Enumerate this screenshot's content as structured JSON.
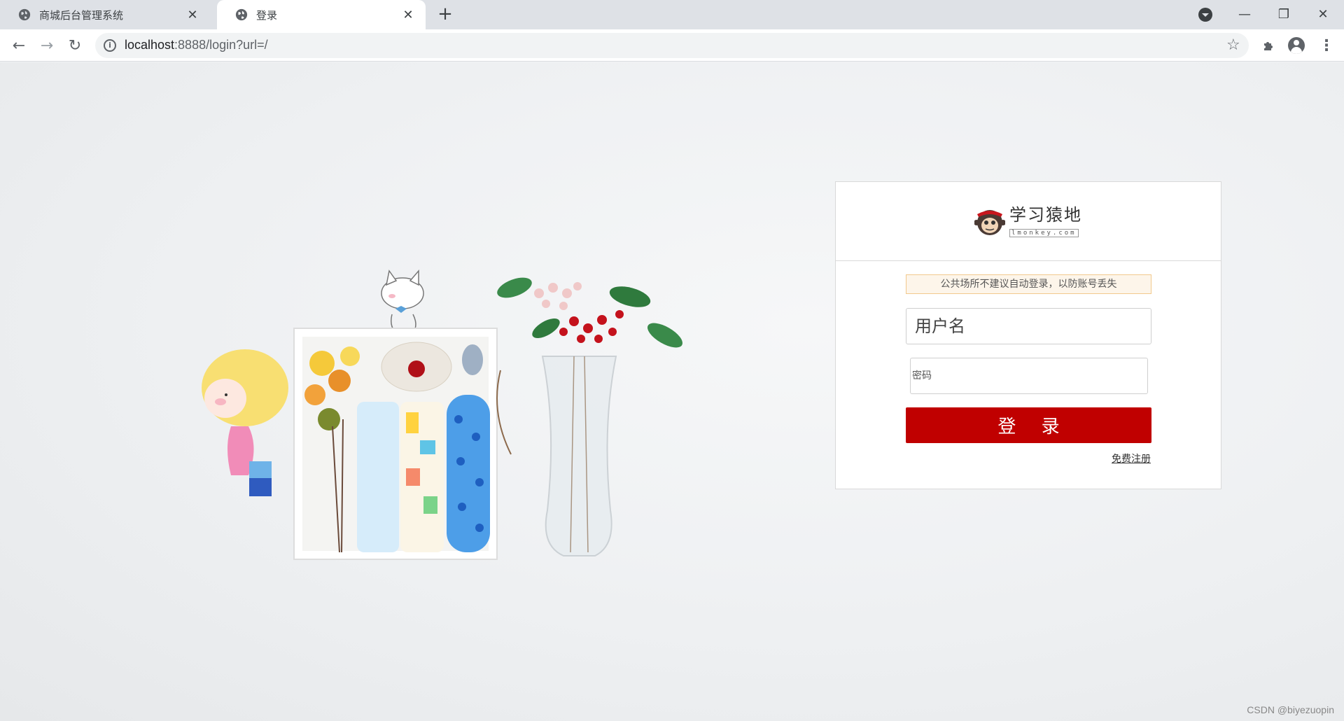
{
  "browser": {
    "tabs": [
      {
        "title": "商城后台管理系统",
        "active": false
      },
      {
        "title": "登录",
        "active": true
      }
    ],
    "new_tab_symbol": "+",
    "url_host": "localhost",
    "url_path": ":8888/login?url=/",
    "icons": [
      "back-icon",
      "forward-icon",
      "reload-icon",
      "info-icon",
      "star-icon",
      "extensions-icon",
      "profile-icon",
      "menu-icon"
    ]
  },
  "login": {
    "logo_name": "学习猿地",
    "logo_domain": "lmonkey.com",
    "notice": "公共场所不建议自动登录，以防账号丢失",
    "username_placeholder": "用户名",
    "password_placeholder": "密码",
    "submit_label": "登 录",
    "register_label": "免费注册",
    "button_color": "#c00000"
  },
  "watermark": "CSDN @biyezuopin"
}
